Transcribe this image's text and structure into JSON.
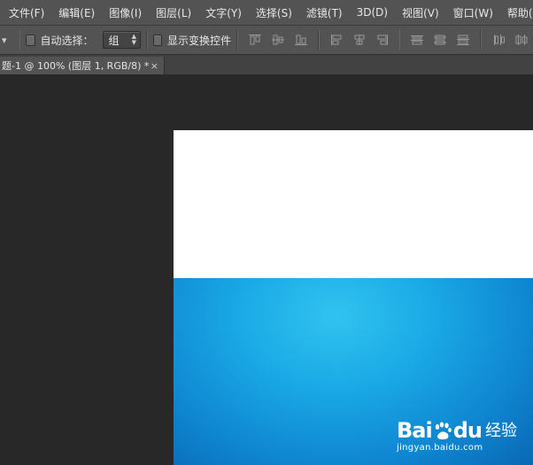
{
  "menu": [
    "文件(F)",
    "编辑(E)",
    "图像(I)",
    "图层(L)",
    "文字(Y)",
    "选择(S)",
    "滤镜(T)",
    "3D(D)",
    "视图(V)",
    "窗口(W)",
    "帮助(H)"
  ],
  "options": {
    "tool_stub": "▾",
    "auto_select_label": "自动选择：",
    "auto_select_checked": false,
    "auto_select_target": "组",
    "show_transform_label": "显示变换控件",
    "show_transform_checked": false
  },
  "document_tab": {
    "title": "题-1 @ 100% (图层 1, RGB/8) *",
    "close": "×"
  },
  "colors": {
    "chrome": "#535353",
    "workspace": "#282828",
    "canvas_top": "#ffffff",
    "canvas_image": "#1aa9e6"
  },
  "watermark": {
    "brand": "Bai",
    "brand_suffix": "du",
    "jingyan": "经验",
    "url": "jingyan.baidu.com"
  }
}
